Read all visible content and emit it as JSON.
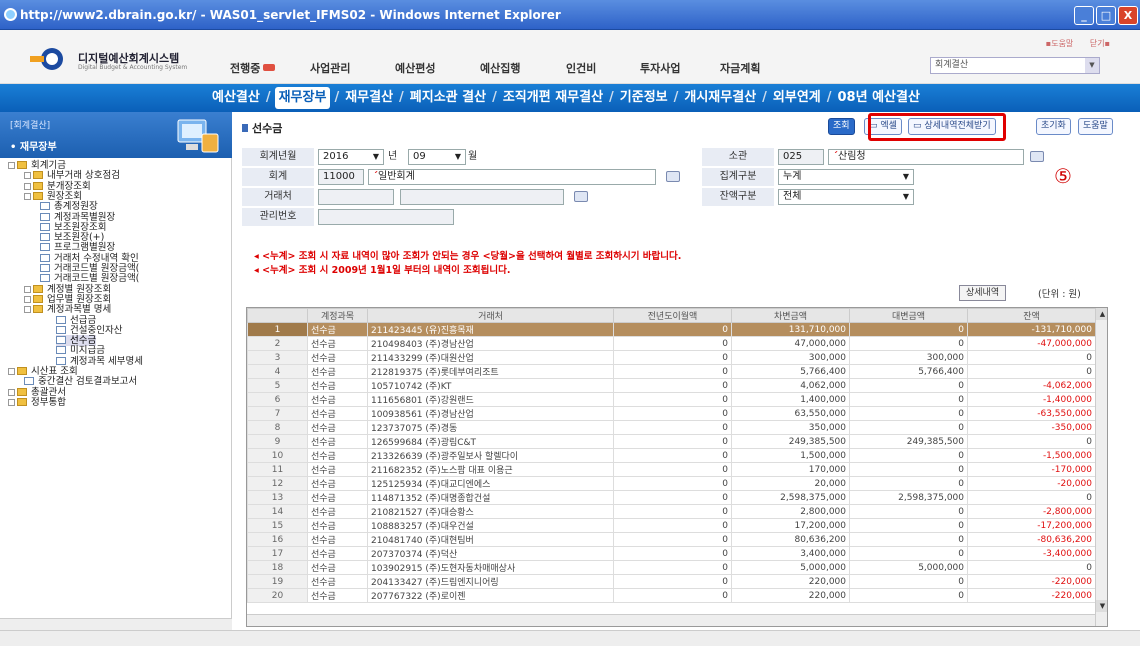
{
  "window": {
    "title": "http://www2.dbrain.go.kr/ - WAS01_servlet_IFMS02 - Windows Internet Explorer",
    "min_btn": "_",
    "max_btn": "□",
    "close_btn": "X"
  },
  "header": {
    "logo_title": "디지털예산회계시스템",
    "logo_sub": "Digital Budget & Accounting System",
    "util_links": [
      "▪도움말",
      "닫기▪"
    ],
    "top_nav": [
      "전행중",
      "사업관리",
      "예산편성",
      "예산집행",
      "인건비",
      "투자사업",
      "자금계획"
    ],
    "year_select": "회계결산"
  },
  "tabs": [
    "예산결산",
    "재무장부",
    "재무결산",
    "폐지소관 결산",
    "조직개편 재무결산",
    "기준정보",
    "개시재무결산",
    "외부연계",
    "08년 예산결산"
  ],
  "tab_active_index": 1,
  "sidebar": {
    "title": "[회계결산]",
    "subtitle": "• 재무장부",
    "tree": [
      {
        "label": "회계기금",
        "icon": "folder-icon",
        "level": 0
      },
      {
        "label": "내부거래 상호점검",
        "icon": "folder-icon",
        "level": 1
      },
      {
        "label": "분개장조회",
        "icon": "folder-icon",
        "level": 1
      },
      {
        "label": "원장조회",
        "icon": "folder-icon",
        "level": 1
      },
      {
        "label": "총계정원장",
        "icon": "doc-icon",
        "level": 2
      },
      {
        "label": "계정과목별원장",
        "icon": "doc-icon",
        "level": 2
      },
      {
        "label": "보조원장조회",
        "icon": "doc-icon",
        "level": 2
      },
      {
        "label": "보조원장(+)",
        "icon": "doc-icon",
        "level": 2
      },
      {
        "label": "프로그램별원장",
        "icon": "doc-icon",
        "level": 2
      },
      {
        "label": "거래처 수정내역 확인",
        "icon": "doc-icon",
        "level": 2
      },
      {
        "label": "거래코드별 원장금액(",
        "icon": "doc-icon",
        "level": 2
      },
      {
        "label": "거래코드별 원장금액(",
        "icon": "doc-icon",
        "level": 2
      },
      {
        "label": "계정별 원장조회",
        "icon": "folder-icon",
        "level": 1
      },
      {
        "label": "업무별 원장조회",
        "icon": "folder-icon",
        "level": 1
      },
      {
        "label": "계정과목별 명세",
        "icon": "folder-icon",
        "level": 1
      },
      {
        "label": "선급금",
        "icon": "doc-icon",
        "level": 3
      },
      {
        "label": "건설중인자산",
        "icon": "doc-icon",
        "level": 3
      },
      {
        "label": "선수금",
        "icon": "doc-icon",
        "level": 3
      },
      {
        "label": "미지급금",
        "icon": "doc-icon",
        "level": 3
      },
      {
        "label": "계정과목 세부명세",
        "icon": "doc-icon",
        "level": 3
      },
      {
        "label": "시산표 조회",
        "icon": "folder-icon",
        "level": 0
      },
      {
        "label": "중간결산 검토결과보고서",
        "icon": "doc-icon",
        "level": 1
      },
      {
        "label": "총괄관서",
        "icon": "folder-icon",
        "level": 0
      },
      {
        "label": "정부통합",
        "icon": "folder-icon",
        "level": 0
      }
    ],
    "selected_index": 17
  },
  "main": {
    "title": "선수금",
    "buttons": [
      "조회",
      "엑셀",
      "상세내역전체받기",
      "초기화",
      "도움말"
    ],
    "annotation": "⑤",
    "form": {
      "year_label": "회계년월",
      "year": "2016",
      "year_unit": "년",
      "month": "09",
      "month_unit": "월",
      "dept_label": "소관",
      "dept_code": "025",
      "dept_name": "산림청",
      "account_label": "회계",
      "account_code": "11000",
      "account_name": "일반회계",
      "agg_label": "집계구분",
      "agg_value": "누계",
      "client_label": "거래처",
      "balance_label": "잔액구분",
      "balance_value": "전체",
      "mgmt_label": "관리번호"
    },
    "notices": [
      "◂ <누계> 조회 시 자료 내역이 많아 조회가 안되는 경우 <당월>을 선택하여 월별로 조회하시기 바랍니다.",
      "◂ <누계> 조회 시 2009년 1월1일 부터의 내역이 조회됩니다."
    ],
    "detail_button": "상세내역",
    "unit": "(단위 : 원)"
  },
  "grid": {
    "headers": [
      "",
      "계정과목",
      "거래처",
      "전년도이월액",
      "차변금액",
      "대변금액",
      "잔액"
    ],
    "rows": [
      [
        "1",
        "선수금",
        "211423445 (유)진흥목재",
        "0",
        "131,710,000",
        "0",
        "-131,710,000"
      ],
      [
        "2",
        "선수금",
        "210498403 (주)경남산업",
        "0",
        "47,000,000",
        "0",
        "-47,000,000"
      ],
      [
        "3",
        "선수금",
        "211433299 (주)대원산업",
        "0",
        "300,000",
        "300,000",
        "0"
      ],
      [
        "4",
        "선수금",
        "212819375 (주)롯데부여리조트",
        "0",
        "5,766,400",
        "5,766,400",
        "0"
      ],
      [
        "5",
        "선수금",
        "105710742 (주)KT",
        "0",
        "4,062,000",
        "0",
        "-4,062,000"
      ],
      [
        "6",
        "선수금",
        "111656801 (주)강원랜드",
        "0",
        "1,400,000",
        "0",
        "-1,400,000"
      ],
      [
        "7",
        "선수금",
        "100938561 (주)경남산업",
        "0",
        "63,550,000",
        "0",
        "-63,550,000"
      ],
      [
        "8",
        "선수금",
        "123737075 (주)경동",
        "0",
        "350,000",
        "0",
        "-350,000"
      ],
      [
        "9",
        "선수금",
        "126599684 (주)광림C&T",
        "0",
        "249,385,500",
        "249,385,500",
        "0"
      ],
      [
        "10",
        "선수금",
        "213326639 (주)광주일보사 할렐다이",
        "0",
        "1,500,000",
        "0",
        "-1,500,000"
      ],
      [
        "11",
        "선수금",
        "211682352 (주)노스팜 대표 이용근",
        "0",
        "170,000",
        "0",
        "-170,000"
      ],
      [
        "12",
        "선수금",
        "125125934 (주)대교디엔에스",
        "0",
        "20,000",
        "0",
        "-20,000"
      ],
      [
        "13",
        "선수금",
        "114871352 (주)대명종합건설",
        "0",
        "2,598,375,000",
        "2,598,375,000",
        "0"
      ],
      [
        "14",
        "선수금",
        "210821527 (주)대승황스",
        "0",
        "2,800,000",
        "0",
        "-2,800,000"
      ],
      [
        "15",
        "선수금",
        "108883257 (주)대우건설",
        "0",
        "17,200,000",
        "0",
        "-17,200,000"
      ],
      [
        "16",
        "선수금",
        "210481740 (주)대현팀버",
        "0",
        "80,636,200",
        "0",
        "-80,636,200"
      ],
      [
        "17",
        "선수금",
        "207370374 (주)덕산",
        "0",
        "3,400,000",
        "0",
        "-3,400,000"
      ],
      [
        "18",
        "선수금",
        "103902915 (주)도현자동차매매상사",
        "0",
        "5,000,000",
        "5,000,000",
        "0"
      ],
      [
        "19",
        "선수금",
        "204133427 (주)드림엔지니어링",
        "0",
        "220,000",
        "0",
        "-220,000"
      ],
      [
        "20",
        "선수금",
        "207767322 (주)로이젠",
        "0",
        "220,000",
        "0",
        "-220,000"
      ]
    ],
    "highlight_row": 0
  }
}
